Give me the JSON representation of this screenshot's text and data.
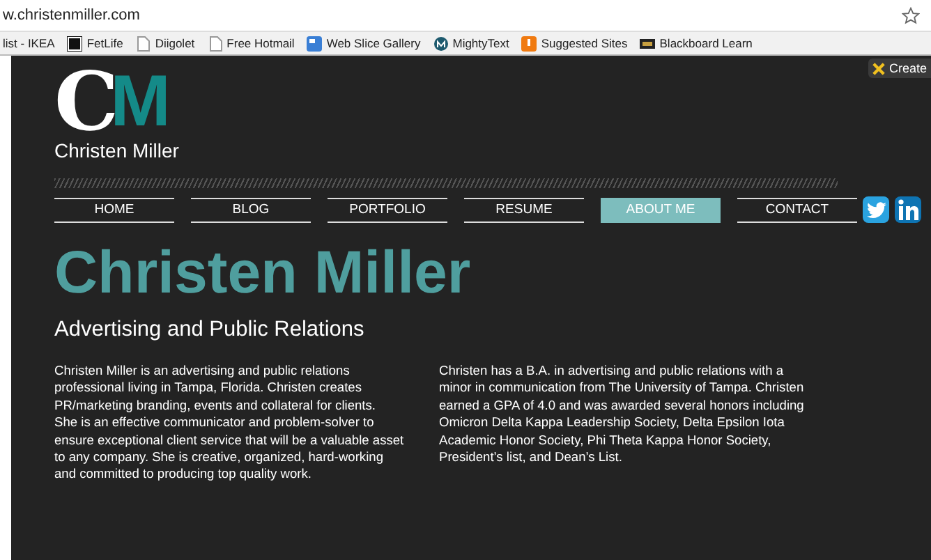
{
  "browser": {
    "address": "w.christenmiller.com",
    "bookmarks": [
      {
        "label": "list - IKEA",
        "kind": "plain"
      },
      {
        "label": "FetLife",
        "kind": "logo"
      },
      {
        "label": "Diigolet",
        "kind": "page"
      },
      {
        "label": "Free Hotmail",
        "kind": "page"
      },
      {
        "label": "Web Slice Gallery",
        "kind": "slice"
      },
      {
        "label": "MightyText",
        "kind": "mighty"
      },
      {
        "label": "Suggested Sites",
        "kind": "suggest"
      },
      {
        "label": "Blackboard Learn",
        "kind": "board"
      }
    ],
    "extension_button": "Create"
  },
  "logo": {
    "letter_1": "C",
    "letter_2": "M",
    "name": "Christen Miller"
  },
  "nav": [
    {
      "label": "HOME",
      "selected": false
    },
    {
      "label": "BLOG",
      "selected": false
    },
    {
      "label": "PORTFOLIO",
      "selected": false
    },
    {
      "label": "RESUME",
      "selected": false
    },
    {
      "label": "ABOUT ME",
      "selected": true
    },
    {
      "label": "CONTACT",
      "selected": false
    }
  ],
  "heading": "Christen Miller",
  "subheading": "Advertising and Public Relations",
  "paragraphs": [
    [
      "Christen Miller is an advertising and public relations",
      "professional living in Tampa, Florida. Christen creates",
      "PR/marketing branding, events and collateral for clients.",
      "She is an effective communicator and problem-solver to",
      "ensure exceptional client service that will be a valuable asset",
      "to any company.  She is creative, organized, hard-working",
      "and committed to producing top quality work."
    ],
    [
      "Christen has a B.A. in advertising and public relations with a",
      "minor in communication from The University of Tampa. Christen",
      "earned a GPA of 4.0 and was awarded several honors including",
      "Omicron Delta Kappa Leadership Society, Delta Epsilon Iota",
      "Academic Honor Society, Phi Theta Kappa Honor Society,",
      "President’s list, and Dean’s List."
    ]
  ]
}
